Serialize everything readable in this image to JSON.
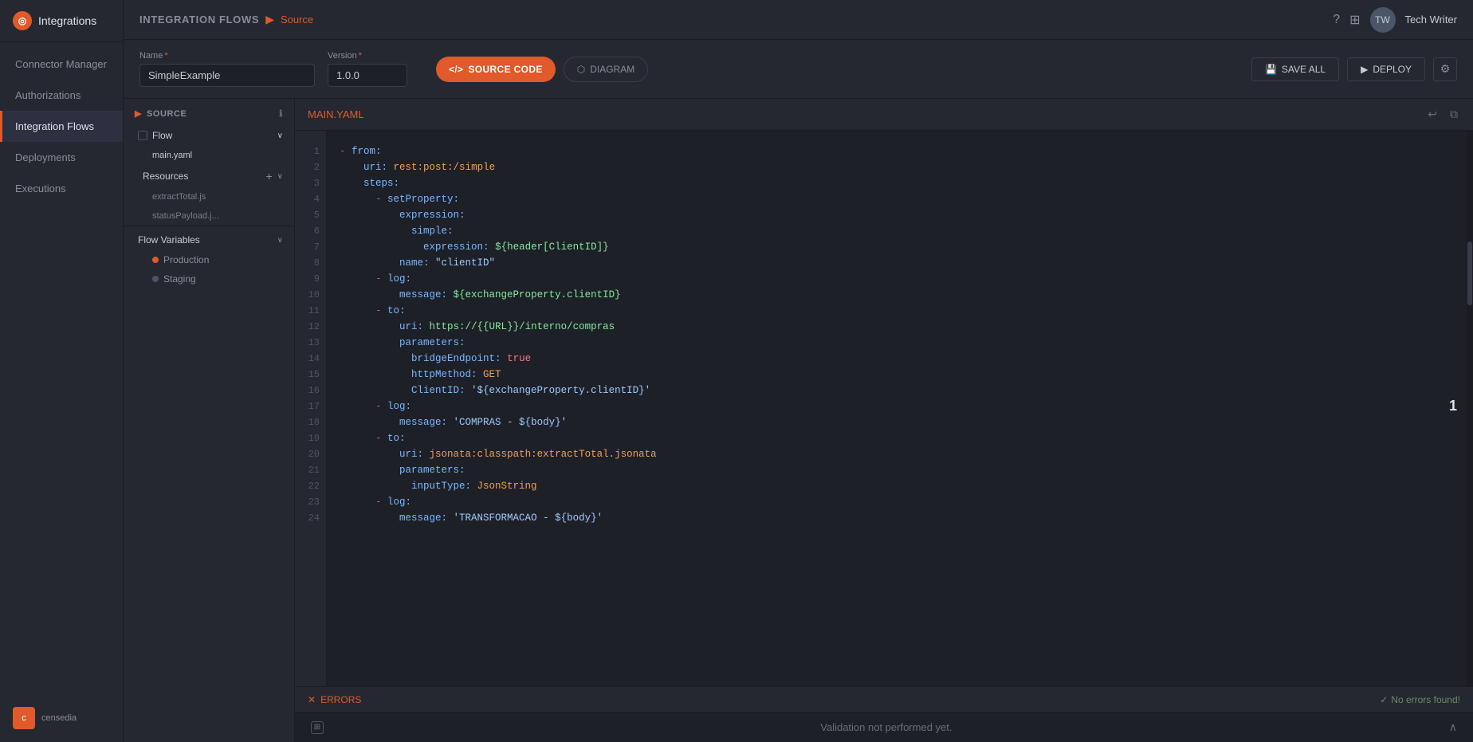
{
  "app": {
    "name": "Integrations"
  },
  "sidebar": {
    "items": [
      {
        "id": "connector-manager",
        "label": "Connector Manager",
        "active": false
      },
      {
        "id": "authorizations",
        "label": "Authorizations",
        "active": false
      },
      {
        "id": "integration-flows",
        "label": "Integration Flows",
        "active": true
      },
      {
        "id": "deployments",
        "label": "Deployments",
        "active": false
      },
      {
        "id": "executions",
        "label": "Executions",
        "active": false
      }
    ],
    "bottom_text": "censedia"
  },
  "topbar": {
    "breadcrumb_main": "INTEGRATION FLOWS",
    "breadcrumb_separator": "▶",
    "breadcrumb_current": "Source",
    "username": "Tech Writer",
    "help_icon": "?",
    "grid_icon": "⊞"
  },
  "header_form": {
    "name_label": "Name",
    "name_required": "*",
    "name_value": "SimpleExample",
    "version_label": "Version",
    "version_required": "*",
    "version_value": "1.0.0",
    "btn_source_code": "SOURCE CODE",
    "btn_diagram": "DIAGRAM",
    "btn_save_all": "SAVE ALL",
    "btn_deploy": "DEPLOY"
  },
  "left_panel": {
    "section_label": "SOURCE",
    "flow_label": "Flow",
    "main_yaml": "main.yaml",
    "resources_label": "Resources",
    "file1": "extractTotal.js",
    "file2": "statusPayload.j...",
    "flow_variables_label": "Flow Variables",
    "production_label": "Production",
    "staging_label": "Staging"
  },
  "editor": {
    "filename": "MAIN.YAML",
    "code_lines": [
      "- from:",
      "    uri: rest:post:/simple",
      "    steps:",
      "      - setProperty:",
      "          expression:",
      "            simple:",
      "              expression: ${header[ClientID]}",
      "          name: \"clientID\"",
      "      - log:",
      "          message: ${exchangeProperty.clientID}",
      "      - to:",
      "          uri: https://{{URL}}/interno/compras",
      "          parameters:",
      "            bridgeEndpoint: true",
      "            httpMethod: GET",
      "            ClientID: '${exchangeProperty.clientID}'",
      "      - log:",
      "          message: 'COMPRAS - ${body}'",
      "      - to:",
      "          uri: jsonata:classpath:extractTotal.jsonata",
      "          parameters:",
      "            inputType: JsonString",
      "      - log:",
      "          message: 'TRANSFORMACAO - ${body}'"
    ],
    "cursor_number": "1",
    "no_errors_text": "No errors found!",
    "errors_label": "ERRORS",
    "validation_text": "Validation not performed yet."
  }
}
